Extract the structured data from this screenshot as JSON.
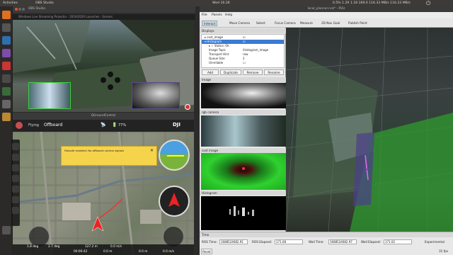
{
  "topbar": {
    "left_title": "Activities",
    "app_name": "OBS Studio",
    "center_time": "Wed 16:28",
    "net_stats": "0.5% 1.29 1.18 169.0 116.33 MB/s 116.33 MB/s",
    "right_title": "local_planner.rviz* - RViz"
  },
  "obs": {
    "window_title": "OBS Studio",
    "title_bar": "Windows Live Streaming Projector - 2019/2020 Launches - Scenes: "
  },
  "qgc": {
    "window_title": "QGroundControl",
    "mode_label": "Offboard",
    "flying_label": "Flying",
    "battery_pct": "77%",
    "logo": "DJI",
    "warning_text": "Failsafe enabled: No offboard control signals",
    "status": {
      "alt": "1.8 deg",
      "alt2": "2.7 deg",
      "dist": "127.2 m",
      "speed": "0.0 m/s",
      "time": "00:00:42",
      "rel": "0.0 m",
      "gps": "0.0 m",
      "misc": "0.0 m/s"
    }
  },
  "rviz": {
    "menu": [
      "File",
      "Panels",
      "Help"
    ],
    "tools": [
      "Interact",
      "Move Camera",
      "Select",
      "Focus Camera",
      "Measure",
      "2D Nav Goal",
      "Publish Point"
    ],
    "displays_title": "Displays",
    "displays": [
      {
        "label": "cost_image",
        "checked": true
      },
      {
        "label": "Histogram",
        "checked": true
      }
    ],
    "props": [
      {
        "k": "Status: Ok",
        "v": ""
      },
      {
        "k": "Image Topic",
        "v": "/histogram_image"
      },
      {
        "k": "Transport Hint",
        "v": "raw"
      },
      {
        "k": "Queue Size",
        "v": "2"
      },
      {
        "k": "Unreliable",
        "v": ""
      }
    ],
    "buttons": [
      "Add",
      "Duplicate",
      "Remove",
      "Rename"
    ],
    "panels": [
      "Image",
      "rgb camera",
      "cost image",
      "Histogram"
    ],
    "time": {
      "title": "Time",
      "ros_time_label": "ROS Time:",
      "ros_time": "1688524682.91",
      "ros_elapsed_label": "ROS Elapsed:",
      "ros_elapsed": "171.08",
      "wall_time_label": "Wall Time:",
      "wall_time": "1688524682.97",
      "wall_elapsed_label": "Wall Elapsed:",
      "wall_elapsed": "171.02",
      "reset": "Reset",
      "experimental": "Experimental",
      "fps": "31 fps"
    }
  },
  "colors": {
    "accent_green": "#3ad13a",
    "qgc_warning": "#f5d44c",
    "rviz_selected": "#3a7bd5"
  }
}
